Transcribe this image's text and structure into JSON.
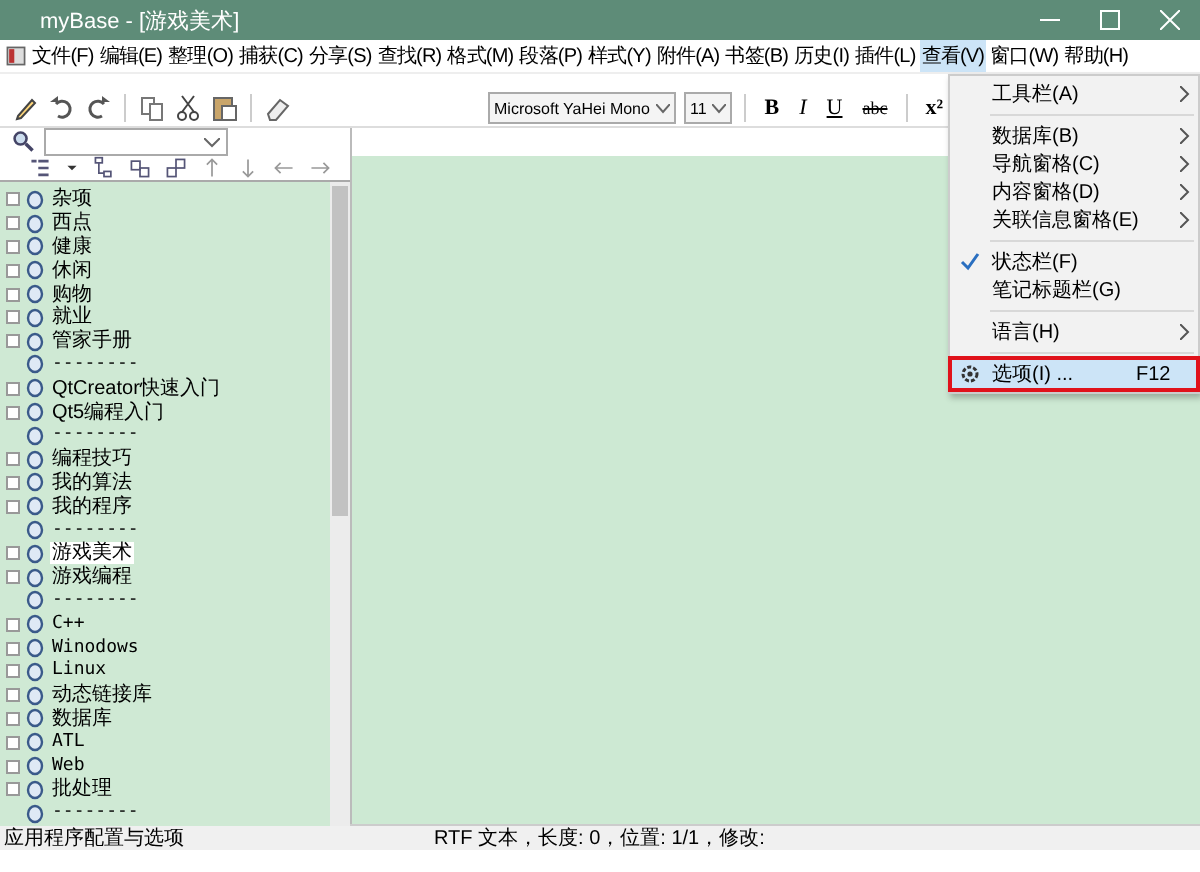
{
  "window": {
    "title": "myBase - [游戏美术]"
  },
  "menu_bar": [
    {
      "label": "文件(F)",
      "selected": false
    },
    {
      "label": "编辑(E)",
      "selected": false
    },
    {
      "label": "整理(O)",
      "selected": false
    },
    {
      "label": "捕获(C)",
      "selected": false
    },
    {
      "label": "分享(S)",
      "selected": false
    },
    {
      "label": "查找(R)",
      "selected": false
    },
    {
      "label": "格式(M)",
      "selected": false
    },
    {
      "label": "段落(P)",
      "selected": false
    },
    {
      "label": "样式(Y)",
      "selected": false
    },
    {
      "label": "附件(A)",
      "selected": false
    },
    {
      "label": "书签(B)",
      "selected": false
    },
    {
      "label": "历史(I)",
      "selected": false
    },
    {
      "label": "插件(L)",
      "selected": false
    },
    {
      "label": "查看(V)",
      "selected": true
    },
    {
      "label": "窗口(W)",
      "selected": false
    },
    {
      "label": "帮助(H)",
      "selected": false
    }
  ],
  "format_toolbar": {
    "font": "Microsoft YaHei Mono",
    "size": "11",
    "bold": "B",
    "italic": "I",
    "underline": "U",
    "strike": "abc",
    "superscript": "x²"
  },
  "menu": [
    {
      "kind": "submenu",
      "label": "工具栏(A)",
      "checked": false,
      "selected": false
    },
    {
      "kind": "separator"
    },
    {
      "kind": "submenu",
      "label": "数据库(B)",
      "checked": false,
      "selected": false
    },
    {
      "kind": "submenu",
      "label": "导航窗格(C)",
      "checked": false,
      "selected": false
    },
    {
      "kind": "submenu",
      "label": "内容窗格(D)",
      "checked": false,
      "selected": false
    },
    {
      "kind": "submenu",
      "label": "关联信息窗格(E)",
      "checked": false,
      "selected": false
    },
    {
      "kind": "separator"
    },
    {
      "kind": "command",
      "label": "状态栏(F)",
      "checked": true,
      "selected": false
    },
    {
      "kind": "command",
      "label": "笔记标题栏(G)",
      "checked": false,
      "selected": false
    },
    {
      "kind": "separator"
    },
    {
      "kind": "submenu",
      "label": "语言(H)",
      "checked": false,
      "selected": false
    },
    {
      "kind": "separator"
    },
    {
      "kind": "command",
      "label": "选项(I) ...",
      "shortcut": "F12",
      "checked": false,
      "selected": true
    }
  ],
  "tree": [
    {
      "label": "杂项",
      "expandable": true,
      "selected": false
    },
    {
      "label": "西点",
      "expandable": true,
      "selected": false
    },
    {
      "label": "健康",
      "expandable": true,
      "selected": false
    },
    {
      "label": "休闲",
      "expandable": true,
      "selected": false
    },
    {
      "label": "购物",
      "expandable": true,
      "selected": false
    },
    {
      "label": "就业",
      "expandable": true,
      "selected": false
    },
    {
      "label": "管家手册",
      "expandable": true,
      "selected": false
    },
    {
      "label": "--------",
      "expandable": false,
      "selected": false
    },
    {
      "label": "QtCreator快速入门",
      "expandable": true,
      "selected": false
    },
    {
      "label": "Qt5编程入门",
      "expandable": true,
      "selected": false
    },
    {
      "label": "--------",
      "expandable": false,
      "selected": false
    },
    {
      "label": "编程技巧",
      "expandable": true,
      "selected": false
    },
    {
      "label": "我的算法",
      "expandable": true,
      "selected": false
    },
    {
      "label": "我的程序",
      "expandable": true,
      "selected": false
    },
    {
      "label": "--------",
      "expandable": false,
      "selected": false
    },
    {
      "label": "游戏美术",
      "expandable": true,
      "selected": true
    },
    {
      "label": "游戏编程",
      "expandable": true,
      "selected": false
    },
    {
      "label": "--------",
      "expandable": false,
      "selected": false
    },
    {
      "label": "C++",
      "expandable": true,
      "selected": false
    },
    {
      "label": "Winodows",
      "expandable": true,
      "selected": false
    },
    {
      "label": "Linux",
      "expandable": true,
      "selected": false
    },
    {
      "label": "动态链接库",
      "expandable": true,
      "selected": false
    },
    {
      "label": "数据库",
      "expandable": true,
      "selected": false
    },
    {
      "label": "ATL",
      "expandable": true,
      "selected": false
    },
    {
      "label": "Web",
      "expandable": true,
      "selected": false
    },
    {
      "label": "批处理",
      "expandable": true,
      "selected": false
    },
    {
      "label": "--------",
      "expandable": false,
      "selected": false
    }
  ],
  "status_bar": {
    "hint": "应用程序配置与选项",
    "info": "RTF 文本，长度: 0，位置: 1/1，修改:"
  }
}
